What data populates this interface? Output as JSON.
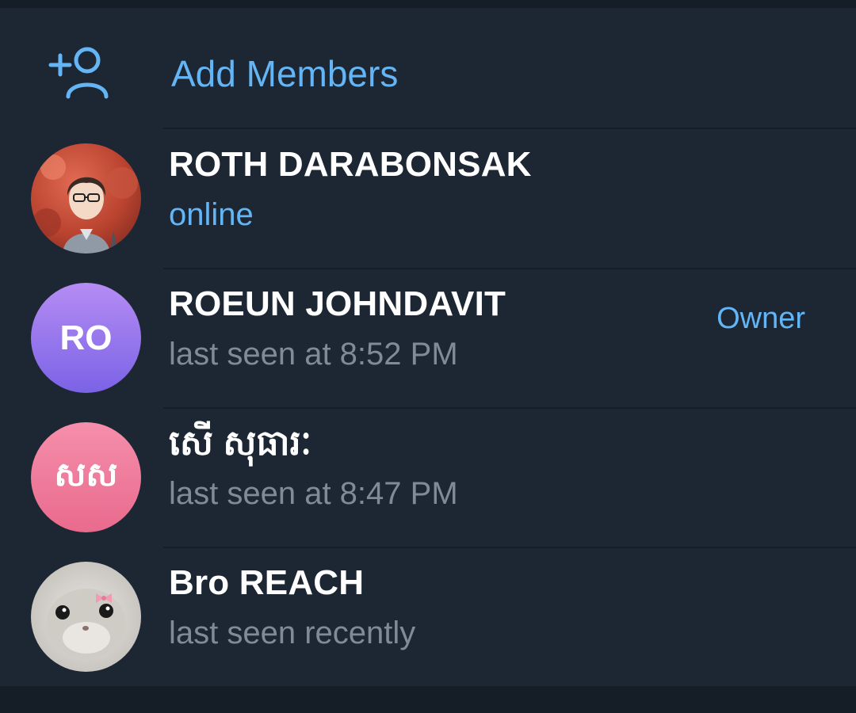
{
  "add_members": {
    "label": "Add Members",
    "icon": "add-person-icon",
    "color": "#64b5f6"
  },
  "members": [
    {
      "name": "ROTH DARABONSAK",
      "status": "online",
      "role": "",
      "avatar": {
        "type": "photo",
        "icon": "anime-boy-avatar"
      }
    },
    {
      "name": "ROEUN JOHNDAVIT",
      "status": "last seen at 8:52 PM",
      "role": "Owner",
      "avatar": {
        "type": "initials",
        "initials": "RO",
        "gradient": [
          "#b58cf3",
          "#7b63e6"
        ]
      }
    },
    {
      "name": "សើ សុធារៈ",
      "status": "last seen at 8:47 PM",
      "role": "",
      "avatar": {
        "type": "initials",
        "initials": "សស",
        "gradient": [
          "#f58fab",
          "#e96a8d"
        ]
      }
    },
    {
      "name": "Bro REACH",
      "status": "last seen recently",
      "role": "",
      "avatar": {
        "type": "photo",
        "icon": "hamster-avatar"
      }
    }
  ],
  "colors": {
    "background": "#1d2733",
    "divider": "#151e27",
    "accent": "#64b5f6",
    "name": "#ffffff",
    "status": "#7f8b96"
  }
}
